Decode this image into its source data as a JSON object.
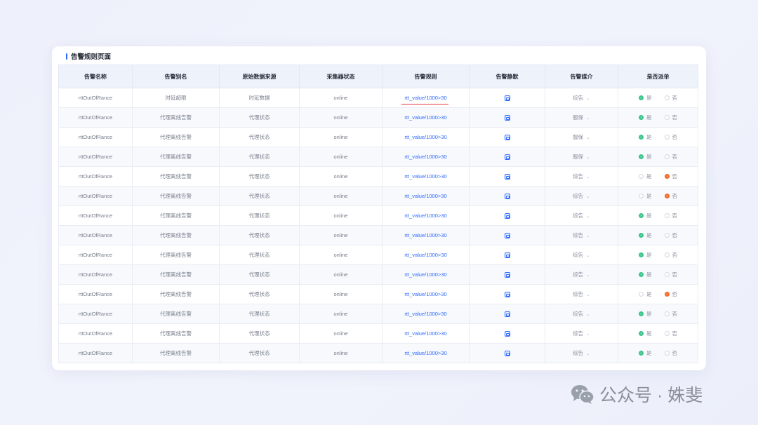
{
  "page": {
    "title": "告警规则页面"
  },
  "table": {
    "headers": [
      "告警名称",
      "告警别名",
      "原始数据来源",
      "采集器状态",
      "告警规则",
      "告警静默",
      "告警媒介",
      "是否派单"
    ],
    "radio_yes": "是",
    "radio_no": "否",
    "rows": [
      {
        "name": "rttOutOfRance",
        "alias": "时延超限",
        "source": "时延数据",
        "status": "online",
        "rule": "rtt_value/1000>30",
        "media": "综告",
        "dispatch": "yes"
      },
      {
        "name": "rttOutOfRance",
        "alias": "代理离线告警",
        "source": "代理状态",
        "status": "online",
        "rule": "rtt_value/1000>30",
        "media": "服保",
        "dispatch": "yes"
      },
      {
        "name": "rttOutOfRance",
        "alias": "代理离线告警",
        "source": "代理状态",
        "status": "online",
        "rule": "rtt_value/1000>30",
        "media": "服保",
        "dispatch": "yes"
      },
      {
        "name": "rttOutOfRance",
        "alias": "代理离线告警",
        "source": "代理状态",
        "status": "online",
        "rule": "rtt_value/1000>30",
        "media": "服保",
        "dispatch": "yes"
      },
      {
        "name": "rttOutOfRance",
        "alias": "代理离线告警",
        "source": "代理状态",
        "status": "online",
        "rule": "rtt_value/1000>30",
        "media": "综告",
        "dispatch": "no"
      },
      {
        "name": "rttOutOfRance",
        "alias": "代理离线告警",
        "source": "代理状态",
        "status": "online",
        "rule": "rtt_value/1000>30",
        "media": "综告",
        "dispatch": "no"
      },
      {
        "name": "rttOutOfRance",
        "alias": "代理离线告警",
        "source": "代理状态",
        "status": "online",
        "rule": "rtt_value/1000>30",
        "media": "综告",
        "dispatch": "yes"
      },
      {
        "name": "rttOutOfRance",
        "alias": "代理离线告警",
        "source": "代理状态",
        "status": "online",
        "rule": "rtt_value/1000>30",
        "media": "综告",
        "dispatch": "yes"
      },
      {
        "name": "rttOutOfRance",
        "alias": "代理离线告警",
        "source": "代理状态",
        "status": "online",
        "rule": "rtt_value/1000>30",
        "media": "综告",
        "dispatch": "yes"
      },
      {
        "name": "rttOutOfRance",
        "alias": "代理离线告警",
        "source": "代理状态",
        "status": "online",
        "rule": "rtt_value/1000>30",
        "media": "综告",
        "dispatch": "yes"
      },
      {
        "name": "rttOutOfRance",
        "alias": "代理离线告警",
        "source": "代理状态",
        "status": "online",
        "rule": "rtt_value/1000>30",
        "media": "综告",
        "dispatch": "no"
      },
      {
        "name": "rttOutOfRance",
        "alias": "代理离线告警",
        "source": "代理状态",
        "status": "online",
        "rule": "rtt_value/1000>30",
        "media": "综告",
        "dispatch": "yes"
      },
      {
        "name": "rttOutOfRance",
        "alias": "代理离线告警",
        "source": "代理状态",
        "status": "online",
        "rule": "rtt_value/1000>30",
        "media": "综告",
        "dispatch": "yes"
      },
      {
        "name": "rttOutOfRance",
        "alias": "代理离线告警",
        "source": "代理状态",
        "status": "online",
        "rule": "rtt_value/1000>30",
        "media": "综告",
        "dispatch": "yes"
      }
    ]
  },
  "icons": {
    "silence": "silence-toggle-icon",
    "chevron": "chevron-down-icon",
    "watermark_logo": "wechat-icon"
  },
  "colors": {
    "accent": "#2f6bff",
    "yes": "#3cc48a",
    "no": "#f36a2c",
    "highlight_underline": "#e43b3b"
  },
  "watermark": {
    "text": "公众号 · 姝斐"
  }
}
